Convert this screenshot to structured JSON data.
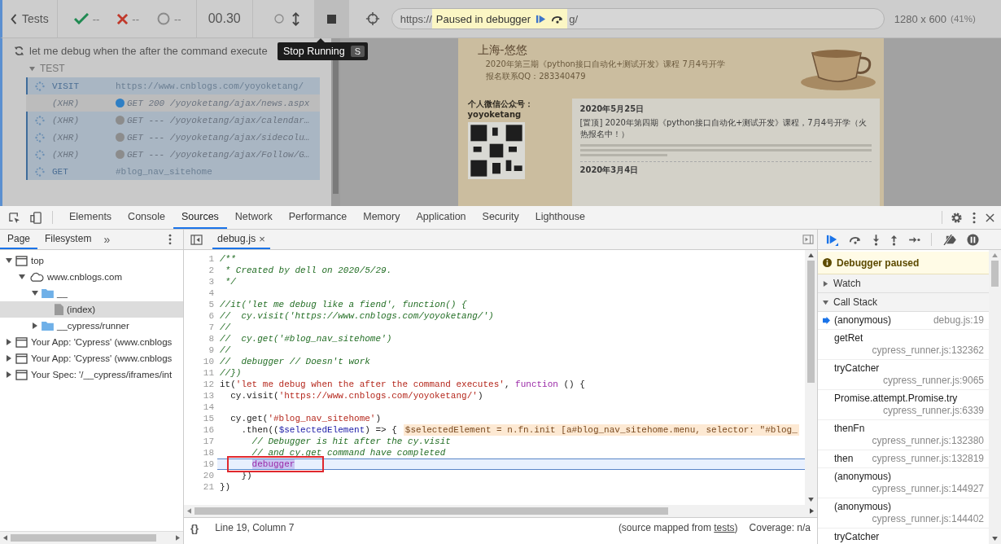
{
  "runner": {
    "back_label": "Tests",
    "passed": "--",
    "failed": "--",
    "pending": "--",
    "duration": "00.30",
    "url_prefix": "https://",
    "paused_label": "Paused in debugger",
    "url_suffix": "g/",
    "viewport": "1280 x 600",
    "scale": "(41%)",
    "tooltip": {
      "label": "Stop Running",
      "key": "S"
    }
  },
  "reporter": {
    "test_title": "let me debug when the after the command execute",
    "suite": {
      "label": "TEST",
      "expanded": true
    },
    "commands": [
      {
        "kind": "command",
        "name": "VISIT",
        "message": "https://www.cnblogs.com/yoyoketang/",
        "pending": true
      },
      {
        "kind": "xhr",
        "name": "(XHR)",
        "message": "GET 200 /yoyoketang/ajax/news.aspx",
        "pending": false,
        "color": "#2f7fc4"
      },
      {
        "kind": "xhr",
        "name": "(XHR)",
        "message": "GET --- /yoyoketang/ajax/calendar…",
        "pending": true,
        "color": "#8c8c8c"
      },
      {
        "kind": "xhr",
        "name": "(XHR)",
        "message": "GET --- /yoyoketang/ajax/sidecolu…",
        "pending": true,
        "color": "#8c8c8c"
      },
      {
        "kind": "xhr",
        "name": "(XHR)",
        "message": "GET --- /yoyoketang/ajax/Follow/G…",
        "pending": true,
        "color": "#8c8c8c"
      },
      {
        "kind": "command",
        "name": "GET",
        "message": "#blog_nav_sitehome",
        "pending": true
      }
    ]
  },
  "preview": {
    "site_title": "上海-悠悠",
    "subtitle": "2020年第三期《python接口自动化+测试开发》课程 7月4号开学",
    "contact": "报名联系QQ：283340479",
    "sidebar_label": "个人微信公众号：yoyoketang",
    "posts": [
      {
        "date": "2020年5月25日",
        "title": "[置顶] 2020年第四期《python接口自动化+测试开发》课程，7月4号开学（火热报名中！）"
      },
      {
        "date": "2020年3月4日"
      }
    ]
  },
  "tabs": [
    {
      "label": "Elements",
      "selected": false
    },
    {
      "label": "Console",
      "selected": false
    },
    {
      "label": "Sources",
      "selected": true
    },
    {
      "label": "Network",
      "selected": false
    },
    {
      "label": "Performance",
      "selected": false
    },
    {
      "label": "Memory",
      "selected": false
    },
    {
      "label": "Application",
      "selected": false
    },
    {
      "label": "Security",
      "selected": false
    },
    {
      "label": "Lighthouse",
      "selected": false
    }
  ],
  "navigator": {
    "tabs": [
      {
        "label": "Page",
        "selected": true
      },
      {
        "label": "Filesystem",
        "selected": false
      }
    ],
    "more": "»",
    "tree": [
      {
        "label": "top",
        "kind": "frame",
        "expanded": true,
        "selected": false,
        "children": [
          {
            "label": "www.cnblogs.com",
            "kind": "cloud",
            "expanded": true,
            "selected": false,
            "children": [
              {
                "label": "__",
                "kind": "folder",
                "expanded": true,
                "selected": false,
                "children": [
                  {
                    "label": "(index)",
                    "kind": "file",
                    "selected": true
                  }
                ]
              },
              {
                "label": "__cypress/runner",
                "kind": "folder",
                "expanded": false,
                "selected": false
              }
            ]
          }
        ]
      },
      {
        "label": "Your App: 'Cypress' (www.cnblogs",
        "kind": "frame",
        "expanded": false,
        "selected": false
      },
      {
        "label": "Your App: 'Cypress' (www.cnblogs",
        "kind": "frame",
        "expanded": false,
        "selected": false
      },
      {
        "label": "Your Spec: '/__cypress/iframes/int",
        "kind": "frame",
        "expanded": false,
        "selected": false
      }
    ]
  },
  "editor": {
    "file": "debug.js",
    "close": "×",
    "lines": [
      {
        "number": "1",
        "current": false,
        "boxed": false,
        "tokens": [
          {
            "kind": "comment",
            "text": "/**"
          }
        ]
      },
      {
        "number": "2",
        "current": false,
        "boxed": false,
        "tokens": [
          {
            "kind": "comment",
            "text": " * Created by dell on 2020/5/29."
          }
        ]
      },
      {
        "number": "3",
        "current": false,
        "boxed": false,
        "tokens": [
          {
            "kind": "comment",
            "text": " */"
          }
        ]
      },
      {
        "number": "4",
        "current": false,
        "boxed": false
      },
      {
        "number": "5",
        "current": false,
        "boxed": false,
        "tokens": [
          {
            "kind": "comment",
            "text": "//it('let me debug like a fiend', function() {"
          }
        ]
      },
      {
        "number": "6",
        "current": false,
        "boxed": false,
        "tokens": [
          {
            "kind": "comment",
            "text": "//  cy.visit('https://www.cnblogs.com/yoyoketang/')"
          }
        ]
      },
      {
        "number": "7",
        "current": false,
        "boxed": false,
        "tokens": [
          {
            "kind": "comment",
            "text": "//"
          }
        ]
      },
      {
        "number": "8",
        "current": false,
        "boxed": false,
        "tokens": [
          {
            "kind": "comment",
            "text": "//  cy.get('#blog_nav_sitehome')"
          }
        ]
      },
      {
        "number": "9",
        "current": false,
        "boxed": false,
        "tokens": [
          {
            "kind": "comment",
            "text": "//"
          }
        ]
      },
      {
        "number": "10",
        "current": false,
        "boxed": false,
        "tokens": [
          {
            "kind": "comment",
            "text": "//  debugger // Doesn't work"
          }
        ]
      },
      {
        "number": "11",
        "current": false,
        "boxed": false,
        "tokens": [
          {
            "kind": "comment",
            "text": "//})"
          }
        ]
      },
      {
        "number": "12",
        "current": false,
        "boxed": false,
        "tokens": [
          {
            "kind": "plain",
            "text": "it("
          },
          {
            "kind": "string",
            "text": "'let me debug when the after the command executes'"
          },
          {
            "kind": "plain",
            "text": ", "
          },
          {
            "kind": "keyword",
            "text": "function"
          },
          {
            "kind": "plain",
            "text": " () {"
          }
        ]
      },
      {
        "number": "13",
        "current": false,
        "boxed": false,
        "tokens": [
          {
            "kind": "plain",
            "text": "  cy.visit("
          },
          {
            "kind": "string",
            "text": "'https://www.cnblogs.com/yoyoketang/'"
          },
          {
            "kind": "plain",
            "text": ")"
          }
        ]
      },
      {
        "number": "14",
        "current": false,
        "boxed": false
      },
      {
        "number": "15",
        "current": false,
        "boxed": false,
        "tokens": [
          {
            "kind": "plain",
            "text": "  cy.get("
          },
          {
            "kind": "string",
            "text": "'#blog_nav_sitehome'"
          },
          {
            "kind": "plain",
            "text": ")"
          }
        ]
      },
      {
        "number": "16",
        "current": false,
        "boxed": false,
        "tokens": [
          {
            "kind": "plain",
            "text": "    .then(("
          },
          {
            "kind": "variable",
            "text": "$selectedElement"
          },
          {
            "kind": "plain",
            "text": ") => {"
          }
        ],
        "inline_value": "$selectedElement = n.fn.init [a#blog_nav_sitehome.menu, selector: \"#blog_"
      },
      {
        "number": "17",
        "current": false,
        "boxed": false,
        "tokens": [
          {
            "kind": "comment",
            "text": "      // Debugger is hit after the cy.visit"
          }
        ]
      },
      {
        "number": "18",
        "current": false,
        "boxed": false,
        "tokens": [
          {
            "kind": "comment",
            "text": "      // and cy.get command have completed"
          }
        ]
      },
      {
        "number": "19",
        "current": true,
        "boxed": true,
        "tokens": [
          {
            "kind": "keyword",
            "text": "      debugger"
          }
        ]
      },
      {
        "number": "20",
        "current": false,
        "boxed": false,
        "tokens": [
          {
            "kind": "plain",
            "text": "    })"
          }
        ]
      },
      {
        "number": "21",
        "current": false,
        "boxed": false,
        "tokens": [
          {
            "kind": "plain",
            "text": "})"
          }
        ]
      }
    ],
    "status": {
      "format": "{}",
      "position": "Line 19, Column 7",
      "source_prefix": "(source mapped from ",
      "source_link": "tests",
      "source_suffix": ")",
      "coverage": "Coverage: n/a"
    }
  },
  "debugger": {
    "paused_label": "Debugger paused",
    "sections": [
      {
        "label": "Watch",
        "expanded": false
      },
      {
        "label": "Call Stack",
        "expanded": true
      }
    ],
    "frames": [
      {
        "kind": "inline",
        "name": "(anonymous)",
        "location": "debug.js:19",
        "selected": true
      },
      {
        "kind": "stacked",
        "name": "getRet",
        "location": "cypress_runner.js:132362",
        "selected": false
      },
      {
        "kind": "stacked",
        "name": "tryCatcher",
        "location": "cypress_runner.js:9065",
        "selected": false
      },
      {
        "kind": "stacked",
        "name": "Promise.attempt.Promise.try",
        "location": "cypress_runner.js:6339",
        "selected": false
      },
      {
        "kind": "stacked",
        "name": "thenFn",
        "location": "cypress_runner.js:132380",
        "selected": false
      },
      {
        "kind": "inline",
        "name": "then",
        "location": "cypress_runner.js:132819",
        "selected": false
      },
      {
        "kind": "stacked",
        "name": "(anonymous)",
        "location": "cypress_runner.js:144927",
        "selected": false
      },
      {
        "kind": "stacked",
        "name": "(anonymous)",
        "location": "cypress_runner.js:144402",
        "selected": false
      },
      {
        "kind": "stacked",
        "name": "tryCatcher",
        "selected": false
      }
    ]
  }
}
